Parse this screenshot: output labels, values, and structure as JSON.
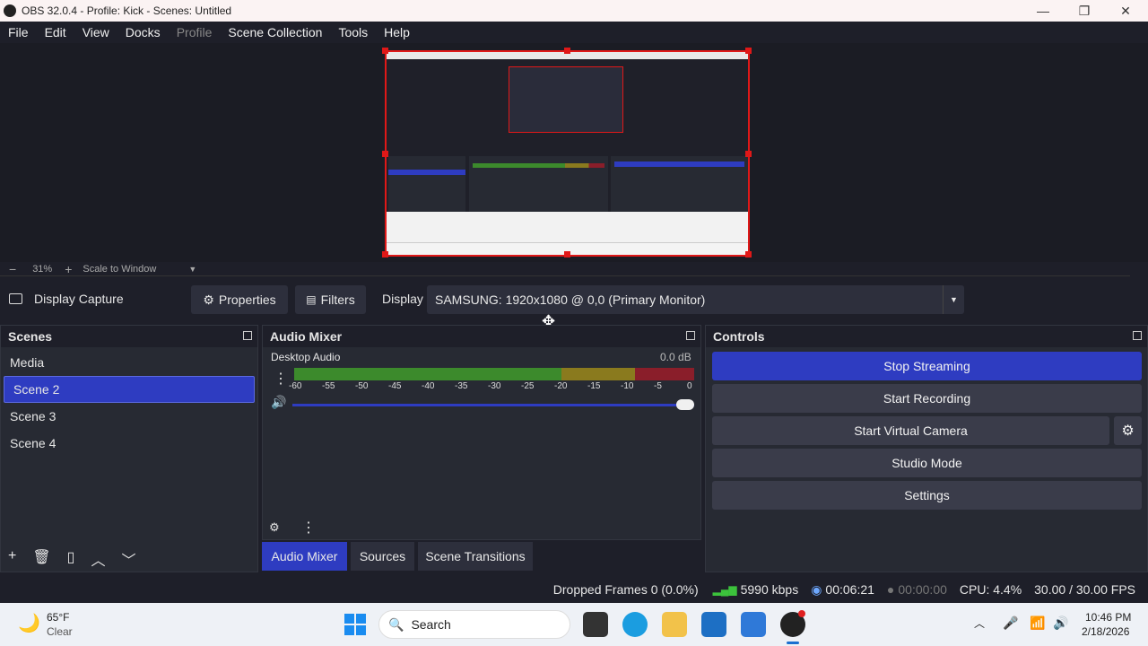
{
  "window": {
    "title": "OBS 32.0.4 - Profile: Kick - Scenes: Untitled",
    "minimize": "—",
    "maximize": "❐",
    "close": "✕"
  },
  "menu": [
    "File",
    "Edit",
    "View",
    "Docks",
    "Profile",
    "Scene Collection",
    "Tools",
    "Help"
  ],
  "zoom": {
    "minus": "−",
    "value": "31%",
    "plus": "+",
    "mode": "Scale to Window"
  },
  "source_bar": {
    "source_name": "Display Capture",
    "properties": "Properties",
    "filters": "Filters",
    "display_label": "Display",
    "display_value": "SAMSUNG: 1920x1080 @ 0,0 (Primary Monitor)"
  },
  "scenes": {
    "title": "Scenes",
    "items": [
      "Media",
      "Scene 2",
      "Scene 3",
      "Scene 4"
    ],
    "selected_index": 1
  },
  "audio_mixer": {
    "title": "Audio Mixer",
    "channel": "Desktop Audio",
    "level": "0.0 dB",
    "ticks": [
      "-60",
      "-55",
      "-50",
      "-45",
      "-40",
      "-35",
      "-30",
      "-25",
      "-20",
      "-15",
      "-10",
      "-5",
      "0"
    ],
    "volume_fraction": 1.0
  },
  "controls": {
    "title": "Controls",
    "stop_streaming": "Stop Streaming",
    "start_recording": "Start Recording",
    "start_virtual_camera": "Start Virtual Camera",
    "studio_mode": "Studio Mode",
    "settings": "Settings"
  },
  "dock_tabs": [
    "Audio Mixer",
    "Sources",
    "Scene Transitions"
  ],
  "status": {
    "dropped_frames": "Dropped Frames 0 (0.0%)",
    "bitrate": "5990 kbps",
    "stream_time": "00:06:21",
    "record_time": "00:00:00",
    "cpu": "CPU: 4.4%",
    "fps": "30.00 / 30.00 FPS"
  },
  "taskbar": {
    "weather_temp": "65°F",
    "weather_desc": "Clear",
    "search": "Search",
    "time": "10:46 PM",
    "date": "2/18/2026"
  },
  "colors": {
    "accent": "#2e3cc1",
    "selection_red": "#e01818",
    "meter_green": "#3c8a2c",
    "meter_yellow": "#8a7a1e",
    "meter_red": "#8a1e2a"
  }
}
